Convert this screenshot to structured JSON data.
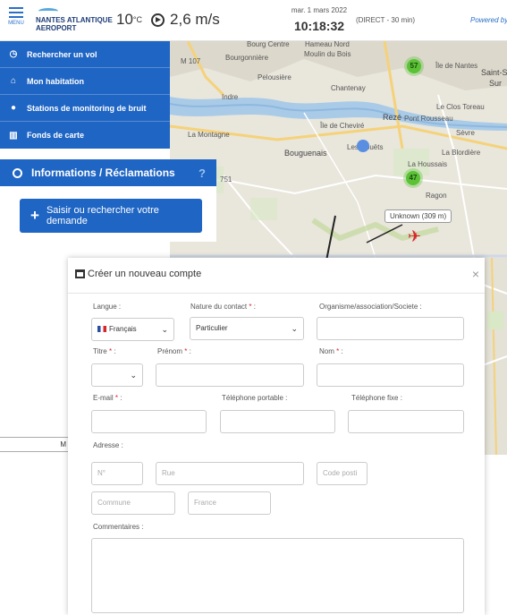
{
  "header": {
    "menu_label": "MENU",
    "logo_line1": "NANTES ATLANTIQUE",
    "logo_line2": "AEROPORT",
    "temperature": "10",
    "temperature_unit": "°C",
    "wind": "2,6 m/s",
    "date": "mar. 1 mars 2022",
    "time": "10:18:32",
    "live_label": "(DIRECT - 30 min)",
    "powered_by": "Powered by"
  },
  "sidebar": {
    "items": [
      {
        "label": "Rechercher un vol",
        "icon": "clock-icon"
      },
      {
        "label": "Mon habitation",
        "icon": "home-icon"
      },
      {
        "label": "Stations de monitoring de bruit",
        "icon": "microphone-icon"
      },
      {
        "label": "Fonds de carte",
        "icon": "map-icon"
      }
    ],
    "info_title": "Informations / Réclamations",
    "info_help": "?",
    "saisir_button": "Saisir ou rechercher votre demande",
    "left_strip_text": "M"
  },
  "map": {
    "labels": {
      "bourg_centre": "Bourg Centre",
      "hameau_nord": "Hameau Nord",
      "moulin_du_bois": "Moulin du Bois",
      "m107": "M 107",
      "bourgonniere": "Bourgonnière",
      "pelousiere": "Pelousière",
      "chantenay": "Chantenay",
      "ile_de_nantes": "Île de Nantes",
      "saint_s": "Saint-S",
      "sur": "Sur",
      "indre": "Indre",
      "le_clos_toreau": "Le Clos Toreau",
      "ile_de_cheviré": "Île de Cheviré",
      "reze": "Rezé",
      "pont_rousseau": "Pont Rousseau",
      "la_montagne": "La Montagne",
      "sevre": "Sèvre",
      "bouguenais": "Bouguenais",
      "les_couets": "Les Couëts",
      "la_blordiere": "La Blordière",
      "la_houssais": "La Houssais",
      "ragon": "Ragon",
      "n751": "751"
    },
    "clusters": [
      "57",
      "47"
    ],
    "unknown_tag": "Unknown (309 m)"
  },
  "modal": {
    "title": "Créer un nouveau compte",
    "close": "×",
    "labels": {
      "langue": "Langue :",
      "nature": "Nature du contact",
      "organisme": "Organisme/association/Societe :",
      "titre": "Titre",
      "prenom": "Prénom",
      "nom": "Nom",
      "email": "E-mail",
      "tel_portable": "Téléphone portable :",
      "tel_fixe": "Téléphone fixe :",
      "adresse": "Adresse :",
      "commentaires": "Commentaires :",
      "required_mark": "*",
      "colon": ":"
    },
    "values": {
      "langue": "Français",
      "nature": "Particulier"
    },
    "placeholders": {
      "numero": "N°",
      "rue": "Rue",
      "code_postal": "Code posti",
      "commune": "Commune",
      "pays": "France"
    }
  }
}
